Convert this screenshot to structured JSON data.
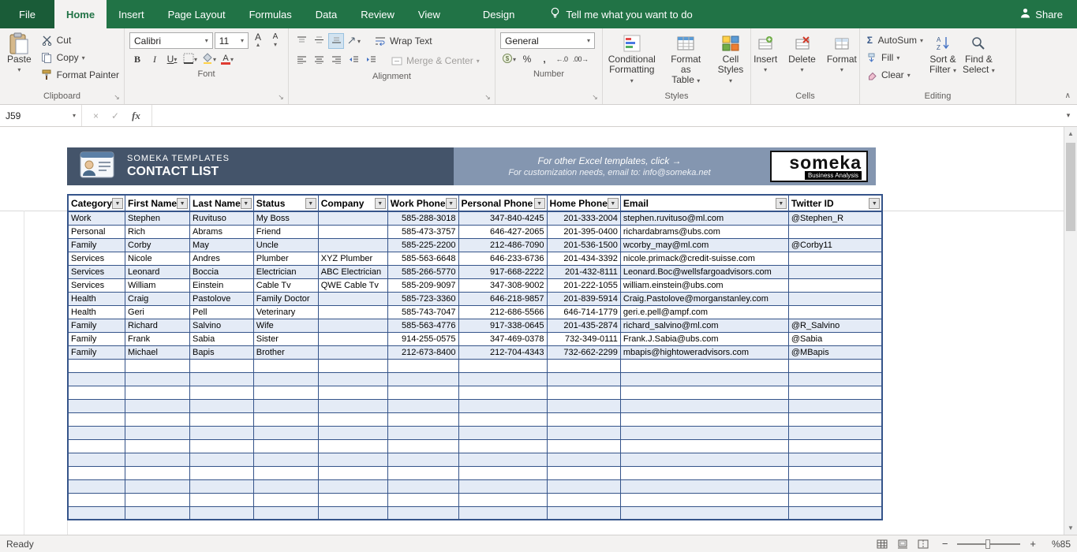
{
  "tabs": [
    {
      "label": "File",
      "file": true
    },
    {
      "label": "Home",
      "active": true
    },
    {
      "label": "Insert"
    },
    {
      "label": "Page Layout"
    },
    {
      "label": "Formulas"
    },
    {
      "label": "Data"
    },
    {
      "label": "Review"
    },
    {
      "label": "View"
    },
    {
      "label": "Design",
      "contextual": true
    }
  ],
  "tell_me": "Tell me what you want to do",
  "share_label": "Share",
  "ribbon": {
    "clipboard": {
      "label": "Clipboard",
      "paste": "Paste",
      "cut": "Cut",
      "copy": "Copy",
      "format_painter": "Format Painter"
    },
    "font": {
      "label": "Font",
      "font_name": "Calibri",
      "font_size": "11"
    },
    "alignment": {
      "label": "Alignment",
      "wrap_text": "Wrap Text",
      "merge_center": "Merge & Center"
    },
    "number": {
      "label": "Number",
      "format": "General"
    },
    "styles": {
      "label": "Styles",
      "conditional_1": "Conditional",
      "conditional_2": "Formatting",
      "format_table_1": "Format as",
      "format_table_2": "Table",
      "cell_styles_1": "Cell",
      "cell_styles_2": "Styles"
    },
    "cells": {
      "label": "Cells",
      "insert": "Insert",
      "delete": "Delete",
      "format": "Format"
    },
    "editing": {
      "label": "Editing",
      "autosum": "AutoSum",
      "fill": "Fill",
      "clear": "Clear",
      "sort_1": "Sort &",
      "sort_2": "Filter",
      "find_1": "Find &",
      "find_2": "Select"
    }
  },
  "formula_bar": {
    "name_box": "J59"
  },
  "banner": {
    "brand": "SOMEKA TEMPLATES",
    "title": "CONTACT LIST",
    "promo_line1": "For other Excel templates, click →",
    "promo_line2": "For customization needs, email to: info@someka.net",
    "logo_text": "someka",
    "logo_sub": "Business Analysis"
  },
  "table": {
    "headers": [
      "Category",
      "First Name",
      "Last Name",
      "Status",
      "Company",
      "Work Phone",
      "Personal Phone",
      "Home Phone",
      "Email",
      "Twitter ID"
    ],
    "rows": [
      [
        "Work",
        "Stephen",
        "Ruvituso",
        "My Boss",
        "",
        "585-288-3018",
        "347-840-4245",
        "201-333-2004",
        "stephen.ruvituso@ml.com",
        "@Stephen_R"
      ],
      [
        "Personal",
        "Rich",
        "Abrams",
        "Friend",
        "",
        "585-473-3757",
        "646-427-2065",
        "201-395-0400",
        "richardabrams@ubs.com",
        ""
      ],
      [
        "Family",
        "Corby",
        "May",
        "Uncle",
        "",
        "585-225-2200",
        "212-486-7090",
        "201-536-1500",
        "wcorby_may@ml.com",
        "@Corby11"
      ],
      [
        "Services",
        "Nicole",
        "Andres",
        "Plumber",
        "XYZ Plumber",
        "585-563-6648",
        "646-233-6736",
        "201-434-3392",
        "nicole.primack@credit-suisse.com",
        ""
      ],
      [
        "Services",
        "Leonard",
        "Boccia",
        "Electrician",
        "ABC Electrician",
        "585-266-5770",
        "917-668-2222",
        "201-432-8111",
        "Leonard.Boc@wellsfargoadvisors.com",
        ""
      ],
      [
        "Services",
        "William",
        "Einstein",
        "Cable Tv",
        "QWE Cable Tv",
        "585-209-9097",
        "347-308-9002",
        "201-222-1055",
        "william.einstein@ubs.com",
        ""
      ],
      [
        "Health",
        "Craig",
        "Pastolove",
        "Family Doctor",
        "",
        "585-723-3360",
        "646-218-9857",
        "201-839-5914",
        "Craig.Pastolove@morganstanley.com",
        ""
      ],
      [
        "Health",
        "Geri",
        "Pell",
        "Veterinary",
        "",
        "585-743-7047",
        "212-686-5566",
        "646-714-1779",
        "geri.e.pell@ampf.com",
        ""
      ],
      [
        "Family",
        "Richard",
        "Salvino",
        "Wife",
        "",
        "585-563-4776",
        "917-338-0645",
        "201-435-2874",
        "richard_salvino@ml.com",
        "@R_Salvino"
      ],
      [
        "Family",
        "Frank",
        "Sabia",
        "Sister",
        "",
        "914-255-0575",
        "347-469-0378",
        "732-349-0111",
        "Frank.J.Sabia@ubs.com",
        "@Sabia"
      ],
      [
        "Family",
        "Michael",
        "Bapis",
        "Brother",
        "",
        "212-673-8400",
        "212-704-4343",
        "732-662-2299",
        "mbapis@hightoweradvisors.com",
        "@MBapis"
      ]
    ],
    "empty_row_count": 12
  },
  "status_bar": {
    "ready": "Ready",
    "zoom": "%85"
  },
  "icons": {
    "caret_down": "▾",
    "filter_arrow": "▼",
    "dialog_launcher": "↘",
    "sigma": "Σ",
    "close": "×",
    "check": "✓",
    "fx": "fx",
    "collapse_ribbon": "∧",
    "scroll_up": "▲",
    "scroll_down": "▼",
    "percent": "%",
    "comma": ",",
    "bold": "B",
    "italic": "I",
    "underline": "U",
    "letter_a": "A",
    "increase_font": "▴",
    "decrease_font": "▾",
    "increase_decimal": "←.0",
    "decrease_decimal": ".00→",
    "minus": "−",
    "plus": "+"
  },
  "colors": {
    "excel_green": "#217346",
    "banner_dark": "#44546A",
    "banner_light": "#8496B0",
    "row_band": "#E4EBF6",
    "table_border": "#35548A"
  }
}
